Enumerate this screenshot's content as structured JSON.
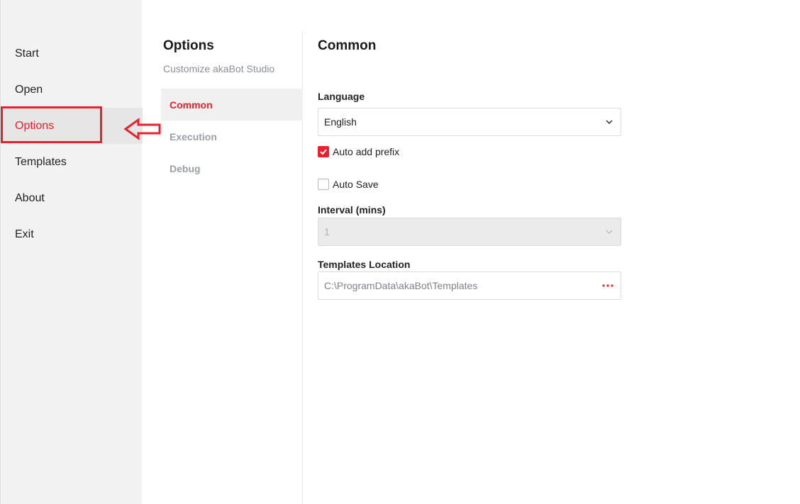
{
  "colors": {
    "accent": "#e8212c",
    "nav_bg": "#f2f2f2",
    "muted": "#9aa0a8"
  },
  "left_nav": {
    "items": [
      {
        "label": "Start"
      },
      {
        "label": "Open"
      },
      {
        "label": "Options"
      },
      {
        "label": "Templates"
      },
      {
        "label": "About"
      },
      {
        "label": "Exit"
      }
    ],
    "active": "Options"
  },
  "options_nav": {
    "title": "Options",
    "subtitle": "Customize akaBot Studio",
    "items": [
      {
        "label": "Common"
      },
      {
        "label": "Execution"
      },
      {
        "label": "Debug"
      }
    ],
    "active": "Common"
  },
  "common": {
    "title": "Common",
    "language_label": "Language",
    "language_value": "English",
    "auto_add_prefix_label": "Auto add prefix",
    "auto_add_prefix_checked": true,
    "auto_save_label": "Auto Save",
    "auto_save_checked": false,
    "interval_label": "Interval (mins)",
    "interval_value": "1",
    "templates_location_label": "Templates Location",
    "templates_location_value": "C:\\ProgramData\\akaBot\\Templates"
  },
  "icons": {
    "dropdown": "chevron-down-icon",
    "checkmark": "checkmark-icon",
    "browse": "ellipsis-icon",
    "annotation": "arrow-left-icon"
  }
}
